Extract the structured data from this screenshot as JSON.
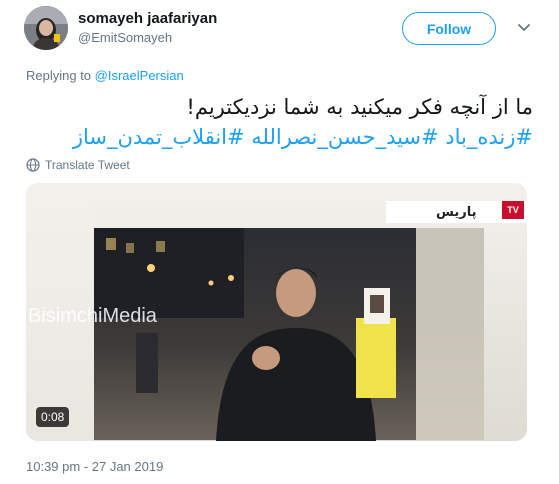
{
  "author": {
    "name": "somayeh jaafariyan",
    "handle": "@EmitSomayeh",
    "avatar_icon": "profile-photo"
  },
  "follow_label": "Follow",
  "reply": {
    "prefix": "Replying to ",
    "to": "@IsraelPersian"
  },
  "tweet": {
    "line1": "ما از آنچه فکر میکنید به شما نزدیکتریم!",
    "hashtags": "#زنده_باد #سید_حسن_نصرالله #انقلاب_تمدن_ساز"
  },
  "translate_label": "Translate Tweet",
  "media": {
    "duration": "0:08",
    "watermark": "BisimchiMedia",
    "city_label": "پاریس",
    "channel_logo": "TV"
  },
  "timestamp": "10:39 pm - 27 Jan 2019",
  "colors": {
    "accent": "#1da1f2",
    "secondary_text": "#657786",
    "primary_text": "#14171a"
  }
}
